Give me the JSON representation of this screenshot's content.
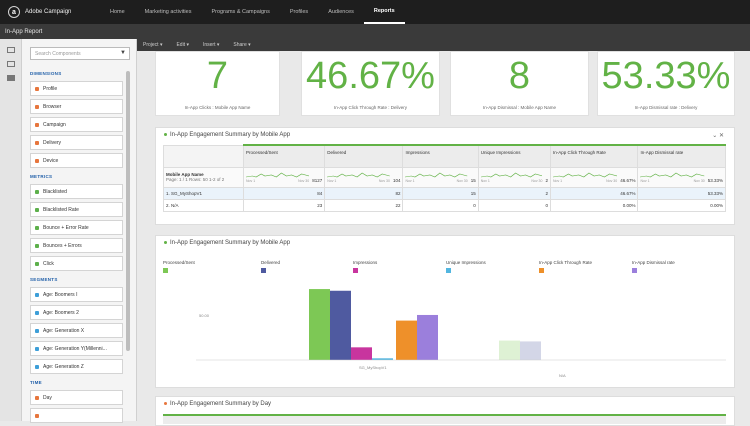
{
  "app": {
    "name": "Adobe Campaign",
    "logo_letter": "a"
  },
  "nav": [
    "Home",
    "Marketing activities",
    "Programs & Campaigns",
    "Profiles",
    "Audiences",
    "Reports"
  ],
  "nav_active": 5,
  "window_title": "In-App Report",
  "menubar": [
    "Project ▾",
    "Edit ▾",
    "Insert ▾",
    "Share ▾"
  ],
  "sidebar": {
    "search_placeholder": "Search Components",
    "sections": {
      "dimensions": "DIMENSIONS",
      "metrics": "METRICS",
      "segments": "SEGMENTS",
      "time": "TIME"
    },
    "dimensions": [
      "Profile",
      "Browser",
      "Campaign",
      "Delivery",
      "Device"
    ],
    "metrics": [
      "Blacklisted",
      "Blacklisted Rate",
      "Bounce + Error Rate",
      "Bounces + Errors",
      "Click"
    ],
    "segments": [
      "Age: Boomers I",
      "Age: Boomers 2",
      "Age: Generation X",
      "Age: Generation Y(Millenni...",
      "Age: Generation Z"
    ],
    "time": [
      "Day",
      ""
    ]
  },
  "kpis": [
    {
      "value": "7",
      "label": "In-App Clicks : Mobile App Name"
    },
    {
      "value": "46.67%",
      "label": "In-App Click Through Rate : Delivery"
    },
    {
      "value": "8",
      "label": "In-App Dismissal : Mobile App Name"
    },
    {
      "value": "53.33%",
      "label": "In-App Dismissal rate : Delivery"
    }
  ],
  "table_panel": {
    "title": "In-App Engagement Summary by Mobile App",
    "header_first": "Mobile App Name",
    "pager": "Page: 1 / 1  Rows: 50  1-2 of 2",
    "columns": [
      "Processed/Sent",
      "Delivered",
      "Impressions",
      "Unique Impressions",
      "In-App Click Through Rate",
      "In-App Dismissal rate"
    ],
    "totals": [
      "8127",
      "104",
      "15",
      "2",
      "46.67%",
      "53.33%"
    ],
    "spark_from": "Nov 1",
    "spark_to": "Nov 30",
    "rows": [
      {
        "idx": "1.",
        "name": "SG_MyShopV1",
        "values": [
          "84",
          "82",
          "15",
          "2",
          "46.67%",
          "53.33%"
        ]
      },
      {
        "idx": "2.",
        "name": "N/A",
        "values": [
          "23",
          "22",
          "0",
          "0",
          "0.00%",
          "0.00%"
        ]
      }
    ]
  },
  "chart_panel": {
    "title": "In-App Engagement Summary by Mobile App",
    "y_tick_label": "50.00",
    "x_label_1": "SG_MyShopV1",
    "x_label_2": "N/A"
  },
  "chart_data": {
    "type": "bar",
    "categories": [
      "SG_MyShopV1",
      "N/A"
    ],
    "series": [
      {
        "name": "Processed/Sent",
        "color": "#7dc855",
        "values": [
          84,
          23
        ]
      },
      {
        "name": "Delivered",
        "color": "#4f5aa0",
        "values": [
          82,
          22
        ]
      },
      {
        "name": "Impressions",
        "color": "#c8359e",
        "values": [
          15,
          0
        ]
      },
      {
        "name": "Unique Impressions",
        "color": "#52b6e0",
        "values": [
          2,
          0
        ]
      },
      {
        "name": "In-App Click Through Rate",
        "color": "#ee902a",
        "values": [
          46.67,
          0
        ]
      },
      {
        "name": "In-App Dismissal rate",
        "color": "#9b7fdc",
        "values": [
          53.33,
          0
        ]
      }
    ],
    "ylim": [
      0,
      90
    ],
    "grid": false,
    "legend": "top"
  },
  "day_panel": {
    "title": "In-App Engagement Summary by Day"
  }
}
